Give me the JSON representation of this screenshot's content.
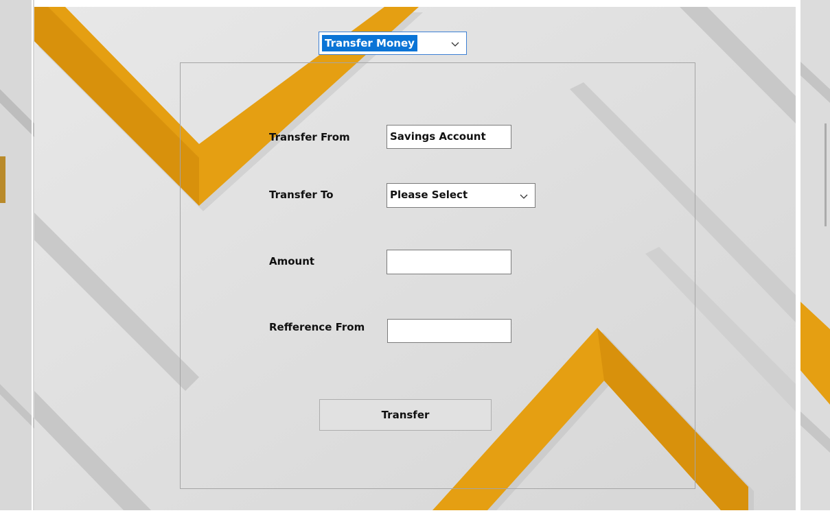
{
  "mode_select": {
    "selected": "Transfer Money"
  },
  "form": {
    "transfer_from": {
      "label": "Transfer From",
      "value": "Savings Account"
    },
    "transfer_to": {
      "label": "Transfer To",
      "selected": "Please Select"
    },
    "amount": {
      "label": "Amount",
      "value": ""
    },
    "reference": {
      "label": "Refference From",
      "value": ""
    },
    "submit_label": "Transfer"
  },
  "colors": {
    "accent_orange": "#e59f12",
    "background_gray": "#dcdcdc",
    "selection_blue": "#0a74d6"
  },
  "icons": [
    "chevron-down-icon"
  ]
}
